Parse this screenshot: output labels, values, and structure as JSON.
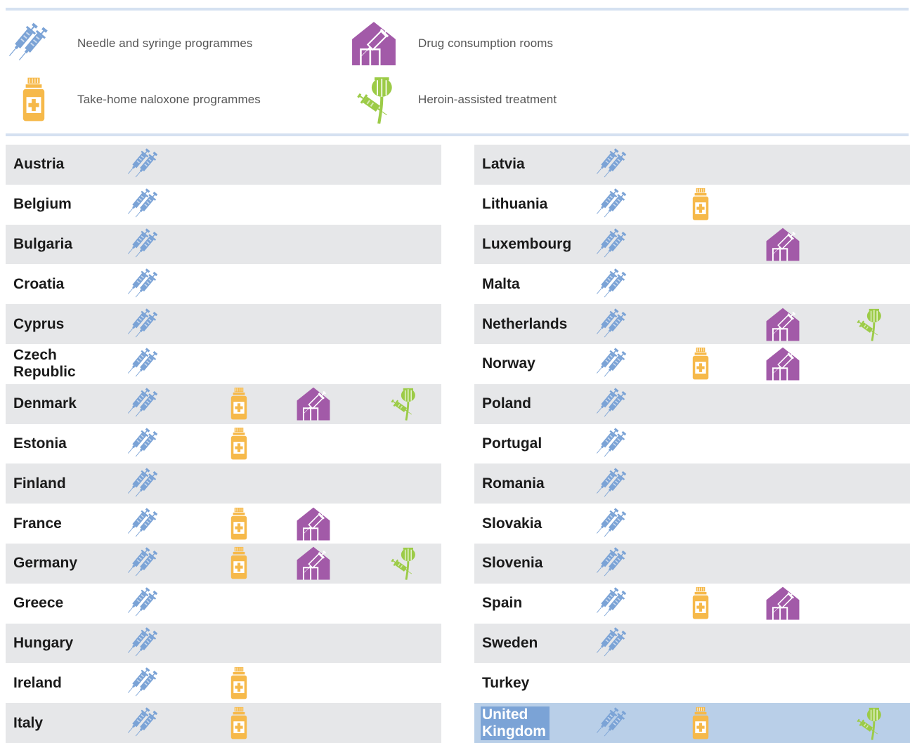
{
  "legend": {
    "items": [
      {
        "icon": "syringe-icon",
        "label": "Needle and syringe programmes"
      },
      {
        "icon": "house-syringe-icon",
        "label": "Drug consumption rooms"
      },
      {
        "icon": "naloxone-bottle-icon",
        "label": "Take-home naloxone programmes"
      },
      {
        "icon": "poppy-syringe-icon",
        "label": "Heroin-assisted treatment"
      }
    ]
  },
  "colors": {
    "syringe": "#7ba3d6",
    "naloxone": "#f6b94a",
    "room": "#a25aa8",
    "heroin": "#9ccb47",
    "row_shade": "#e6e7e9",
    "highlight": "#b9cfe8",
    "rule": "#d5e1f1"
  },
  "left_countries": [
    {
      "name": "Austria",
      "nsp": true,
      "naloxone": false,
      "dcr": false,
      "hat": false
    },
    {
      "name": "Belgium",
      "nsp": true,
      "naloxone": false,
      "dcr": false,
      "hat": false
    },
    {
      "name": "Bulgaria",
      "nsp": true,
      "naloxone": false,
      "dcr": false,
      "hat": false
    },
    {
      "name": "Croatia",
      "nsp": true,
      "naloxone": false,
      "dcr": false,
      "hat": false
    },
    {
      "name": "Cyprus",
      "nsp": true,
      "naloxone": false,
      "dcr": false,
      "hat": false
    },
    {
      "name": "Czech Republic",
      "nsp": true,
      "naloxone": false,
      "dcr": false,
      "hat": false
    },
    {
      "name": "Denmark",
      "nsp": true,
      "naloxone": true,
      "dcr": true,
      "hat": true
    },
    {
      "name": "Estonia",
      "nsp": true,
      "naloxone": true,
      "dcr": false,
      "hat": false
    },
    {
      "name": "Finland",
      "nsp": true,
      "naloxone": false,
      "dcr": false,
      "hat": false
    },
    {
      "name": "France",
      "nsp": true,
      "naloxone": true,
      "dcr": true,
      "hat": false
    },
    {
      "name": "Germany",
      "nsp": true,
      "naloxone": true,
      "dcr": true,
      "hat": true
    },
    {
      "name": "Greece",
      "nsp": true,
      "naloxone": false,
      "dcr": false,
      "hat": false
    },
    {
      "name": "Hungary",
      "nsp": true,
      "naloxone": false,
      "dcr": false,
      "hat": false
    },
    {
      "name": "Ireland",
      "nsp": true,
      "naloxone": true,
      "dcr": false,
      "hat": false
    },
    {
      "name": "Italy",
      "nsp": true,
      "naloxone": true,
      "dcr": false,
      "hat": false
    }
  ],
  "right_countries": [
    {
      "name": "Latvia",
      "nsp": true,
      "naloxone": false,
      "dcr": false,
      "hat": false
    },
    {
      "name": "Lithuania",
      "nsp": true,
      "naloxone": true,
      "dcr": false,
      "hat": false
    },
    {
      "name": "Luxembourg",
      "nsp": true,
      "naloxone": false,
      "dcr": true,
      "hat": false
    },
    {
      "name": "Malta",
      "nsp": true,
      "naloxone": false,
      "dcr": false,
      "hat": false
    },
    {
      "name": "Netherlands",
      "nsp": true,
      "naloxone": false,
      "dcr": true,
      "hat": true
    },
    {
      "name": "Norway",
      "nsp": true,
      "naloxone": true,
      "dcr": true,
      "hat": false
    },
    {
      "name": "Poland",
      "nsp": true,
      "naloxone": false,
      "dcr": false,
      "hat": false
    },
    {
      "name": "Portugal",
      "nsp": true,
      "naloxone": false,
      "dcr": false,
      "hat": false
    },
    {
      "name": "Romania",
      "nsp": true,
      "naloxone": false,
      "dcr": false,
      "hat": false
    },
    {
      "name": "Slovakia",
      "nsp": true,
      "naloxone": false,
      "dcr": false,
      "hat": false
    },
    {
      "name": "Slovenia",
      "nsp": true,
      "naloxone": false,
      "dcr": false,
      "hat": false
    },
    {
      "name": "Spain",
      "nsp": true,
      "naloxone": true,
      "dcr": true,
      "hat": false
    },
    {
      "name": "Sweden",
      "nsp": true,
      "naloxone": false,
      "dcr": false,
      "hat": false
    },
    {
      "name": "Turkey",
      "nsp": false,
      "naloxone": false,
      "dcr": false,
      "hat": false
    },
    {
      "name": "United Kingdom",
      "nsp": true,
      "naloxone": true,
      "dcr": false,
      "hat": true,
      "highlight": true
    }
  ]
}
